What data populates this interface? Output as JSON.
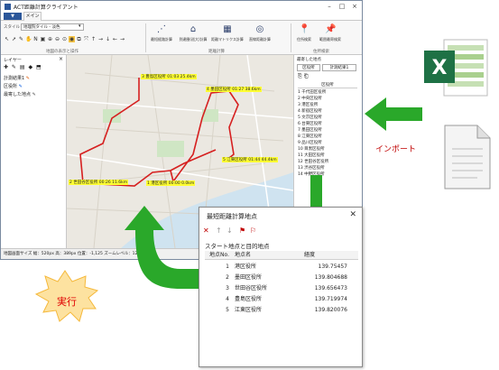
{
  "app": {
    "title": "ACT距離計算クライアント",
    "file_menu": "▼",
    "tab_main": "メイン"
  },
  "ribbon": {
    "style_label": "スタイル",
    "style_value": "地理院タイル - 淡色",
    "group_map": "地図の表示と操作",
    "group_distance": "距離計算",
    "group_lookup": "住所検索",
    "buttons": [
      {
        "label": "最短経路計算",
        "icon": "route-icon"
      },
      {
        "label": "到達圏(巡大)計算",
        "icon": "area-icon"
      },
      {
        "label": "距離マトリクス計算",
        "icon": "grid-icon"
      },
      {
        "label": "直線距離計算",
        "icon": "circle-icon"
      },
      {
        "label": "住所検索",
        "icon": "pin-icon"
      },
      {
        "label": "範囲最寄検索",
        "icon": "pin-flag-icon"
      }
    ]
  },
  "layer_panel": {
    "title": "レイヤー",
    "rows": [
      "計測結果1",
      "区役所",
      "最寄した地点"
    ]
  },
  "map": {
    "labels": [
      "3 豊島区役所 01:03 25.4km",
      "4 墨田区役所 01:27 38.6km",
      "5 江東区役所 01:44 44.4km",
      "2 世田谷区役所 00:26 11.6km",
      "1 港区役所 00:00 0.0km"
    ],
    "route_color": "#d62020",
    "label_bg": "#ffff33"
  },
  "right_panel": {
    "title": "最寄した地点",
    "tabs": [
      "区役所",
      "計測結果1"
    ],
    "col_header": "区役所",
    "rows": [
      "1 千代田区役所",
      "2 中央区役所",
      "3 港区役所",
      "4 新宿区役所",
      "5 文京区役所",
      "6 台東区役所",
      "7 墨田区役所",
      "8 江東区役所",
      "9 品川区役所",
      "10 目黒区役所",
      "11 大田区役所",
      "12 世田谷区役所",
      "13 渋谷区役所",
      "14 中野区役所"
    ]
  },
  "status_bar": {
    "text": "地図画面サイズ 幅：520px 高：389px 位置：-1,125 ズームレベル：12 距離"
  },
  "dialog": {
    "title": "最短距離計算地点",
    "subtitle": "スタート地点と目的地点",
    "columns": [
      "地点No.",
      "地点名",
      "経度"
    ],
    "rows": [
      {
        "no": "1",
        "name": "港区役所",
        "lon": "139.75457"
      },
      {
        "no": "2",
        "name": "墨田区役所",
        "lon": "139.804688"
      },
      {
        "no": "3",
        "name": "世田谷区役所",
        "lon": "139.656473"
      },
      {
        "no": "4",
        "name": "豊島区役所",
        "lon": "139.719974"
      },
      {
        "no": "5",
        "name": "江東区役所",
        "lon": "139.820076"
      }
    ]
  },
  "annotations": {
    "import_label": "インポート",
    "execute_label": "実行",
    "arrow_color": "#2aa82a"
  }
}
